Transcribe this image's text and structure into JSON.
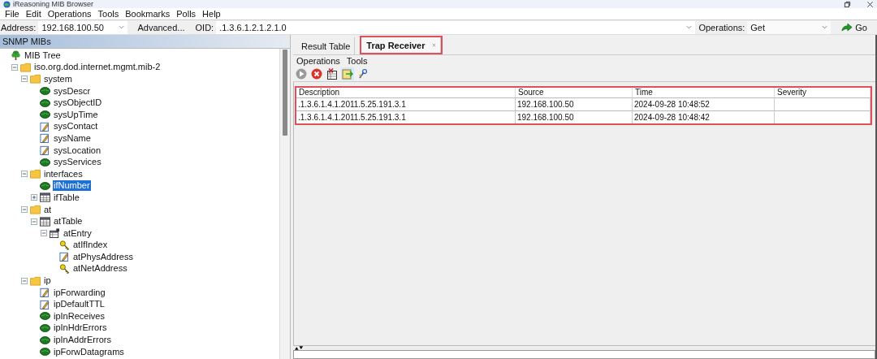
{
  "window": {
    "title": "iReasoning MIB Browser"
  },
  "menu": [
    "File",
    "Edit",
    "Operations",
    "Tools",
    "Bookmarks",
    "Polls",
    "Help"
  ],
  "address_bar": {
    "address_label": "Address:",
    "address": "192.168.100.50",
    "advanced_button": "Advanced...",
    "oid_label": "OID:",
    "oid": ".1.3.6.1.2.1.2.1.0",
    "operations_label": "Operations:",
    "operation": "Get",
    "go_button": "Go"
  },
  "mib_panel": {
    "title": "SNMP MIBs",
    "tree": [
      {
        "label": "MIB Tree",
        "kind": "root",
        "selected": false,
        "children": [
          {
            "label": "iso.org.dod.internet.mgmt.mib-2",
            "kind": "folder",
            "selected": false,
            "expanded": true,
            "children": [
              {
                "label": "system",
                "kind": "folder",
                "selected": false,
                "expanded": true,
                "children": [
                  {
                    "label": "sysDescr",
                    "kind": "leaf",
                    "selected": false
                  },
                  {
                    "label": "sysObjectID",
                    "kind": "leaf",
                    "selected": false
                  },
                  {
                    "label": "sysUpTime",
                    "kind": "leaf",
                    "selected": false
                  },
                  {
                    "label": "sysContact",
                    "kind": "edit",
                    "selected": false
                  },
                  {
                    "label": "sysName",
                    "kind": "edit",
                    "selected": false
                  },
                  {
                    "label": "sysLocation",
                    "kind": "edit",
                    "selected": false
                  },
                  {
                    "label": "sysServices",
                    "kind": "leaf",
                    "selected": false
                  }
                ]
              },
              {
                "label": "interfaces",
                "kind": "folder",
                "selected": false,
                "expanded": true,
                "children": [
                  {
                    "label": "ifNumber",
                    "kind": "leaf",
                    "selected": true
                  },
                  {
                    "label": "ifTable",
                    "kind": "table",
                    "selected": false,
                    "expanded": false
                  }
                ]
              },
              {
                "label": "at",
                "kind": "folder",
                "selected": false,
                "expanded": true,
                "children": [
                  {
                    "label": "atTable",
                    "kind": "table",
                    "selected": false,
                    "expanded": true,
                    "children": [
                      {
                        "label": "atEntry",
                        "kind": "entry",
                        "selected": false,
                        "expanded": true,
                        "children": [
                          {
                            "label": "atIfIndex",
                            "kind": "key",
                            "selected": false
                          },
                          {
                            "label": "atPhysAddress",
                            "kind": "edit",
                            "selected": false
                          },
                          {
                            "label": "atNetAddress",
                            "kind": "key",
                            "selected": false
                          }
                        ]
                      }
                    ]
                  }
                ]
              },
              {
                "label": "ip",
                "kind": "folder",
                "selected": false,
                "expanded": true,
                "children": [
                  {
                    "label": "ipForwarding",
                    "kind": "edit",
                    "selected": false
                  },
                  {
                    "label": "ipDefaultTTL",
                    "kind": "edit",
                    "selected": false
                  },
                  {
                    "label": "ipInReceives",
                    "kind": "leaf",
                    "selected": false
                  },
                  {
                    "label": "ipInHdrErrors",
                    "kind": "leaf",
                    "selected": false
                  },
                  {
                    "label": "ipInAddrErrors",
                    "kind": "leaf",
                    "selected": false
                  },
                  {
                    "label": "ipForwDatagrams",
                    "kind": "leaf",
                    "selected": false
                  }
                ]
              }
            ]
          }
        ]
      }
    ]
  },
  "tabs": [
    {
      "label": "Result Table",
      "selected": false,
      "closable": false,
      "highlighted": false
    },
    {
      "label": "Trap Receiver",
      "selected": true,
      "closable": true,
      "highlighted": true
    }
  ],
  "trap_receiver": {
    "menu": [
      "Operations",
      "Tools"
    ],
    "table": {
      "highlighted": true,
      "columns": [
        "Description",
        "Source",
        "Time",
        "Severity"
      ],
      "rows": [
        [
          ".1.3.6.1.4.1.2011.5.25.191.3.1",
          "192.168.100.50",
          "2024-09-28 10:48:52",
          ""
        ],
        [
          ".1.3.6.1.4.1.2011.5.25.191.3.1",
          "192.168.100.50",
          "2024-09-28 10:48:42",
          ""
        ]
      ]
    }
  }
}
